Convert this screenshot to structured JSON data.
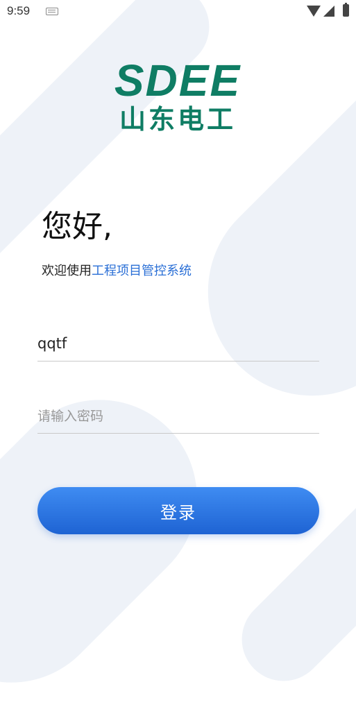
{
  "status_bar": {
    "time": "9:59",
    "icons": [
      "keyboard-icon",
      "wifi-icon",
      "signal-icon",
      "battery-icon"
    ]
  },
  "logo": {
    "english": "SDEE",
    "chinese": "山东电工",
    "color": "#0f7d64"
  },
  "greeting": "您好,",
  "welcome": {
    "prefix": "欢迎使用",
    "system_name": "工程项目管控系统",
    "highlight_color": "#2a6fd6"
  },
  "form": {
    "username_value": "qqtf",
    "password_placeholder": "请输入密码",
    "login_label": "登录"
  },
  "colors": {
    "button_gradient_top": "#3f8cf2",
    "button_gradient_bottom": "#1e63d3",
    "background_shape": "#eef2f8"
  }
}
